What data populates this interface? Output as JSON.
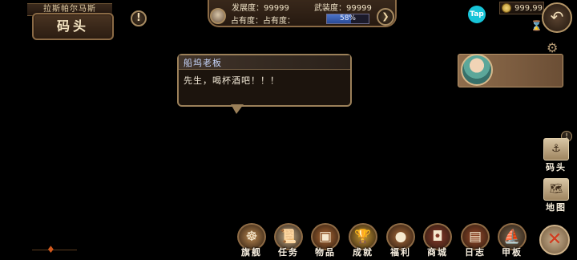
{
  "location": {
    "strip_text": "拉斯帕尔马斯",
    "name": "码头"
  },
  "stats": {
    "development_label": "发展度：",
    "development_value": "99999",
    "armament_label": "武装度：",
    "armament_value": "99999",
    "occupancy_label": "占有度：占有度：",
    "occupancy_percent": 58,
    "occupancy_text": "58%"
  },
  "topright": {
    "tap_label": "Tap",
    "coins": "999,99"
  },
  "dialog": {
    "speaker": "船坞老板",
    "text": "先生，喝杯酒吧！！！"
  },
  "side_buttons": [
    {
      "label": "码头",
      "icon": "dock-icon"
    },
    {
      "label": "地图",
      "icon": "map-icon"
    }
  ],
  "bottom_menu": [
    {
      "label": "旗舰",
      "icon": "helm-icon",
      "color": "#b9874f"
    },
    {
      "label": "任务",
      "icon": "scroll-icon",
      "color": "#c8b08a"
    },
    {
      "label": "物品",
      "icon": "chest-icon",
      "color": "#b06a34"
    },
    {
      "label": "成就",
      "icon": "trophy-icon",
      "color": "#c99a34"
    },
    {
      "label": "福利",
      "icon": "gift-icon",
      "color": "#a86a3a"
    },
    {
      "label": "商城",
      "icon": "treasure-icon",
      "color": "#8a3a2a"
    },
    {
      "label": "日志",
      "icon": "book-icon",
      "color": "#9a4a2a"
    },
    {
      "label": "甲板",
      "icon": "ship-icon",
      "color": "#7a6a54"
    }
  ],
  "colors": {
    "accent_gold": "#a78b62",
    "occupancy_fill": "#4b74c8",
    "tap_brand": "#17c4d8"
  }
}
